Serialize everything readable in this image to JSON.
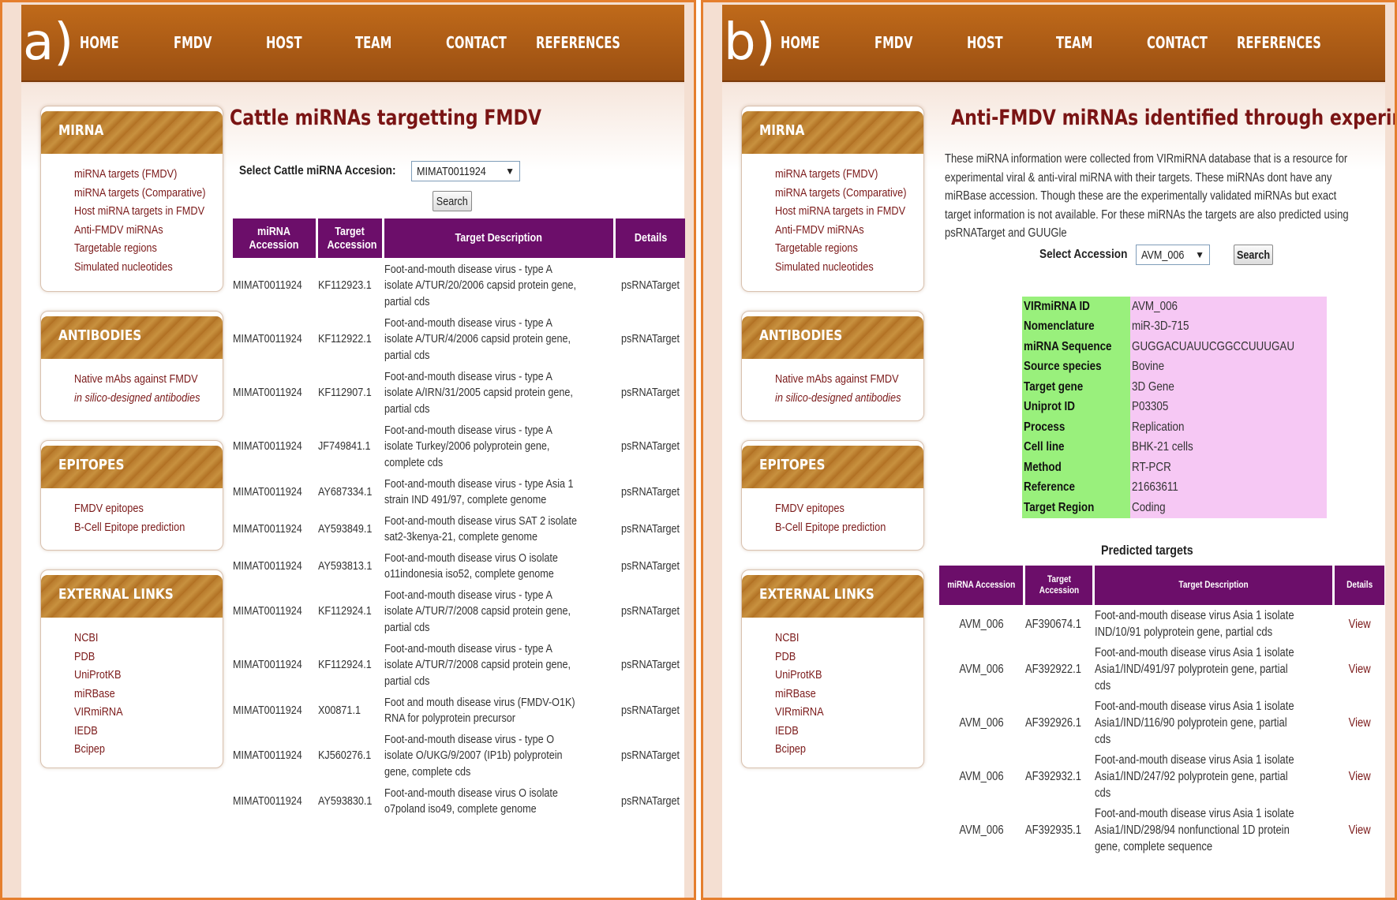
{
  "nav": [
    "HOME",
    "FMDV",
    "HOST",
    "TEAM",
    "CONTACT",
    "REFERENCES"
  ],
  "sidebar": {
    "mirna": {
      "title": "MIRNA",
      "links": [
        "miRNA targets (FMDV)",
        "miRNA targets (Comparative)",
        "Host miRNA targets in FMDV",
        "Anti-FMDV miRNAs",
        "Targetable regions",
        "Simulated nucleotides"
      ]
    },
    "antibodies": {
      "title": "ANTIBODIES",
      "links": [
        "Native mAbs against FMDV",
        "in silico-designed antibodies"
      ]
    },
    "epitopes": {
      "title": "EPITOPES",
      "links": [
        "FMDV epitopes",
        "B-Cell Epitope prediction"
      ]
    },
    "external": {
      "title": "EXTERNAL LINKS",
      "links": [
        "NCBI",
        "PDB",
        "UniProtKB",
        "miRBase",
        "VIRmiRNA",
        "IEDB",
        "Bcipep"
      ]
    }
  },
  "panel_a": {
    "letter": "a)",
    "title": "Cattle miRNAs targetting FMDV",
    "select_label": "Select Cattle miRNA Accesion:",
    "select_value": "MIMAT0011924",
    "search_label": "Search",
    "columns": [
      "miRNA Accession",
      "Target Accession",
      "Target Description",
      "Details"
    ],
    "rows": [
      {
        "acc": "MIMAT0011924",
        "target": "KF112923.1",
        "desc": [
          "Foot-and-mouth disease virus - type A",
          "isolate A/TUR/20/2006 capsid protein gene,",
          "partial cds"
        ],
        "details": "psRNATarget"
      },
      {
        "acc": "MIMAT0011924",
        "target": "KF112922.1",
        "desc": [
          "Foot-and-mouth disease virus - type A",
          "isolate A/TUR/4/2006 capsid protein gene,",
          "partial cds"
        ],
        "details": "psRNATarget"
      },
      {
        "acc": "MIMAT0011924",
        "target": "KF112907.1",
        "desc": [
          "Foot-and-mouth disease virus - type A",
          "isolate A/IRN/31/2005 capsid protein gene,",
          "partial cds"
        ],
        "details": "psRNATarget"
      },
      {
        "acc": "MIMAT0011924",
        "target": "JF749841.1",
        "desc": [
          "Foot-and-mouth disease virus - type A",
          "isolate Turkey/2006 polyprotein gene,",
          "complete cds"
        ],
        "details": "psRNATarget"
      },
      {
        "acc": "MIMAT0011924",
        "target": "AY687334.1",
        "desc": [
          "Foot-and-mouth disease virus - type Asia 1",
          "strain IND 491/97, complete genome"
        ],
        "details": "psRNATarget"
      },
      {
        "acc": "MIMAT0011924",
        "target": "AY593849.1",
        "desc": [
          "Foot-and-mouth disease virus SAT 2 isolate",
          "sat2-3kenya-21, complete genome"
        ],
        "details": "psRNATarget"
      },
      {
        "acc": "MIMAT0011924",
        "target": "AY593813.1",
        "desc": [
          "Foot-and-mouth disease virus O isolate",
          "o11indonesia iso52, complete genome"
        ],
        "details": "psRNATarget"
      },
      {
        "acc": "MIMAT0011924",
        "target": "KF112924.1",
        "desc": [
          "Foot-and-mouth disease virus - type A",
          "isolate A/TUR/7/2008 capsid protein gene,",
          "partial cds"
        ],
        "details": "psRNATarget"
      },
      {
        "acc": "MIMAT0011924",
        "target": "KF112924.1",
        "desc": [
          "Foot-and-mouth disease virus - type A",
          "isolate A/TUR/7/2008 capsid protein gene,",
          "partial cds"
        ],
        "details": "psRNATarget"
      },
      {
        "acc": "MIMAT0011924",
        "target": "X00871.1",
        "desc": [
          "Foot and mouth disease virus (FMDV-O1K)",
          "RNA for polyprotein precursor"
        ],
        "details": "psRNATarget"
      },
      {
        "acc": "MIMAT0011924",
        "target": "KJ560276.1",
        "desc": [
          "Foot-and-mouth disease virus - type O",
          "isolate O/UKG/9/2007 (IP1b) polyprotein",
          "gene, complete cds"
        ],
        "details": "psRNATarget"
      },
      {
        "acc": "MIMAT0011924",
        "target": "AY593830.1",
        "desc": [
          "Foot-and-mouth disease virus O isolate",
          "o7poland iso49, complete genome"
        ],
        "details": "psRNATarget"
      }
    ]
  },
  "panel_b": {
    "letter": "b)",
    "title": "Anti-FMDV miRNAs identified through experiments",
    "description": [
      "These miRNA information were collected from VIRmiRNA database that is a resource for",
      "experimental viral & anti-viral miRNA with their targets. These miRNAs dont have any",
      "miRBase accession. Though these are the experimentally validated miRNAs but exact",
      "target information is not available. For these miRNAs the targets are also predicted using",
      "psRNATarget and GUUGle"
    ],
    "select_label": "Select Accession",
    "select_value": "AVM_006",
    "search_label": "Search",
    "details": [
      {
        "k": "VIRmiRNA ID",
        "v": "AVM_006"
      },
      {
        "k": "Nomenclature",
        "v": "miR-3D-715"
      },
      {
        "k": "miRNA Sequence",
        "v": "GUGGACUAUUCGGCCUUUGAU"
      },
      {
        "k": "Source species",
        "v": "Bovine"
      },
      {
        "k": "Target gene",
        "v": "3D Gene"
      },
      {
        "k": "Uniprot ID",
        "v": "P03305"
      },
      {
        "k": "Process",
        "v": "Replication"
      },
      {
        "k": "Cell line",
        "v": "BHK-21 cells"
      },
      {
        "k": "Method",
        "v": "RT-PCR"
      },
      {
        "k": "Reference",
        "v": "21663611"
      },
      {
        "k": "Target Region",
        "v": "Coding"
      }
    ],
    "predicted_title": "Predicted targets",
    "columns": [
      "miRNA Accession",
      "Target Accession",
      "Target Description",
      "Details"
    ],
    "rows": [
      {
        "acc": "AVM_006",
        "target": "AF390674.1",
        "desc": [
          "Foot-and-mouth disease virus Asia 1 isolate",
          "IND/10/91 polyprotein gene, partial cds"
        ],
        "details": "View"
      },
      {
        "acc": "AVM_006",
        "target": "AF392922.1",
        "desc": [
          "Foot-and-mouth disease virus Asia 1 isolate",
          "Asia1/IND/491/97 polyprotein gene, partial",
          "cds"
        ],
        "details": "View"
      },
      {
        "acc": "AVM_006",
        "target": "AF392926.1",
        "desc": [
          "Foot-and-mouth disease virus Asia 1 isolate",
          "Asia1/IND/116/90 polyprotein gene, partial",
          "cds"
        ],
        "details": "View"
      },
      {
        "acc": "AVM_006",
        "target": "AF392932.1",
        "desc": [
          "Foot-and-mouth disease virus Asia 1 isolate",
          "Asia1/IND/247/92 polyprotein gene, partial",
          "cds"
        ],
        "details": "View"
      },
      {
        "acc": "AVM_006",
        "target": "AF392935.1",
        "desc": [
          "Foot-and-mouth disease virus Asia 1 isolate",
          "Asia1/IND/298/94 nonfunctional 1D protein",
          "gene, complete sequence"
        ],
        "details": "View"
      }
    ]
  }
}
